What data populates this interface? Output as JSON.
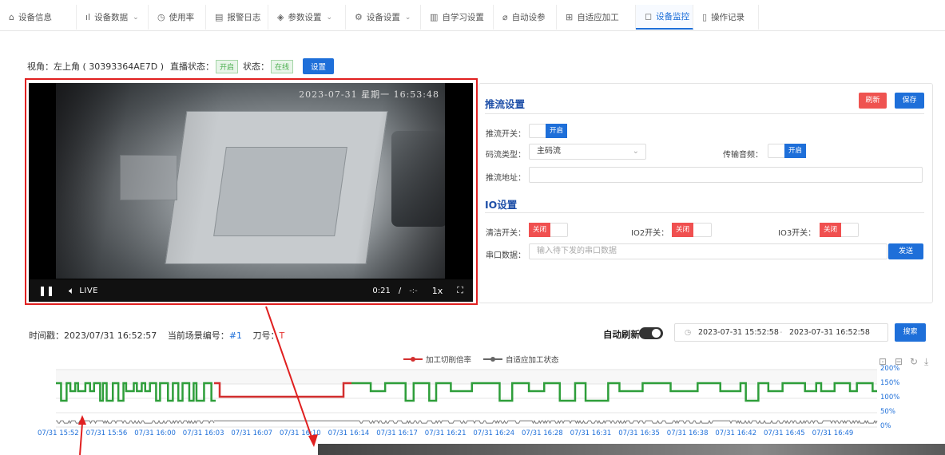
{
  "tabs": [
    {
      "icon": "⌂",
      "label": "设备信息",
      "chev": ""
    },
    {
      "icon": "ıl",
      "label": "设备数据",
      "chev": "⌄"
    },
    {
      "icon": "◷",
      "label": "使用率",
      "chev": ""
    },
    {
      "icon": "▤",
      "label": "报警日志",
      "chev": ""
    },
    {
      "icon": "◈",
      "label": "参数设置",
      "chev": "⌄"
    },
    {
      "icon": "⚙",
      "label": "设备设置",
      "chev": "⌄"
    },
    {
      "icon": "▥",
      "label": "自学习设置",
      "chev": ""
    },
    {
      "icon": "⌀",
      "label": "自动设参",
      "chev": ""
    },
    {
      "icon": "⊞",
      "label": "自适应加工",
      "chev": ""
    },
    {
      "icon": "◻",
      "label": "设备监控",
      "chev": ""
    },
    {
      "icon": "▯",
      "label": "操作记录",
      "chev": ""
    }
  ],
  "view": {
    "label": "视角：左上角 ( 30393364AE7D )",
    "live_label": "直播状态：",
    "live_value": "开启",
    "status_label": "状态：",
    "status_value": "在线",
    "settings_btn": "设置"
  },
  "video": {
    "timestamp": "2023-07-31 星期一 16:53:48",
    "live": "LIVE",
    "time": "0:21",
    "sep": "/",
    "dur": "-:-",
    "speed": "1x"
  },
  "stream": {
    "title": "推流设置",
    "refresh": "刷新",
    "save": "保存",
    "switch_label": "推流开关：",
    "switch_value": "开启",
    "codec_label": "码流类型：",
    "codec_value": "主码流",
    "audio_label": "传输音频：",
    "audio_value": "开启",
    "url_label": "推流地址："
  },
  "io": {
    "title": "IO设置",
    "clean_label": "清洁开关：",
    "clean_value": "关闭",
    "io2_label": "IO2开关：",
    "io2_value": "关闭",
    "io3_label": "IO3开关：",
    "io3_value": "关闭",
    "serial_label": "串口数据：",
    "serial_placeholder": "输入待下发的串口数据",
    "send": "发送"
  },
  "info": {
    "ts_label": "时间戳：2023/07/31 16:52:57",
    "scene_label": "当前场景编号：",
    "scene_value": "#1",
    "tool_label": "刀号：",
    "tool_value": "T",
    "auto_refresh": "自动刷新",
    "start": "2023-07-31 15:52:58",
    "range_sep": "-",
    "end": "2023-07-31 16:52:58",
    "search": "搜索"
  },
  "colors": {
    "accent": "#1e6fd9",
    "green": "#2e9e3a",
    "red": "#d32f2f",
    "gray": "#666666"
  },
  "chart_data": {
    "type": "line",
    "series": [
      {
        "name": "加工切削倍率",
        "color": "#d32f2f"
      },
      {
        "name": "自适应加工状态",
        "color": "#666666"
      }
    ],
    "x": [
      "07/31 15:52",
      "07/31 15:56",
      "07/31 16:00",
      "07/31 16:03",
      "07/31 16:07",
      "07/31 16:10",
      "07/31 16:14",
      "07/31 16:17",
      "07/31 16:21",
      "07/31 16:24",
      "07/31 16:28",
      "07/31 16:31",
      "07/31 16:35",
      "07/31 16:38",
      "07/31 16:42",
      "07/31 16:45",
      "07/31 16:49"
    ],
    "y_ticks": [
      "200%",
      "150%",
      "100%",
      "50%",
      "0%"
    ],
    "ylim": [
      0,
      200
    ],
    "grid": true,
    "legend": "top-center"
  }
}
